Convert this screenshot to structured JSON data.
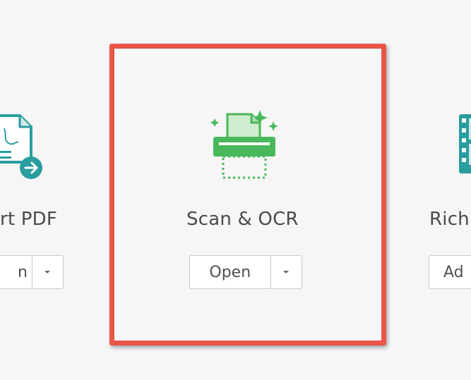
{
  "tools": [
    {
      "id": "left",
      "label": "rt PDF",
      "button_label": "n",
      "icon": "export-pdf-icon",
      "accent": "#2a9d9f"
    },
    {
      "id": "center",
      "label": "Scan & OCR",
      "button_label": "Open",
      "icon": "scanner-icon",
      "accent": "#49b85a"
    },
    {
      "id": "right",
      "label": "Rich",
      "button_label": "Ad",
      "icon": "rich-media-icon",
      "accent": "#2a9d9f"
    }
  ],
  "colors": {
    "background": "#f6f6f6",
    "highlight": "#e95548",
    "text": "#4a4a4a",
    "button_border": "#c9c9c9"
  }
}
